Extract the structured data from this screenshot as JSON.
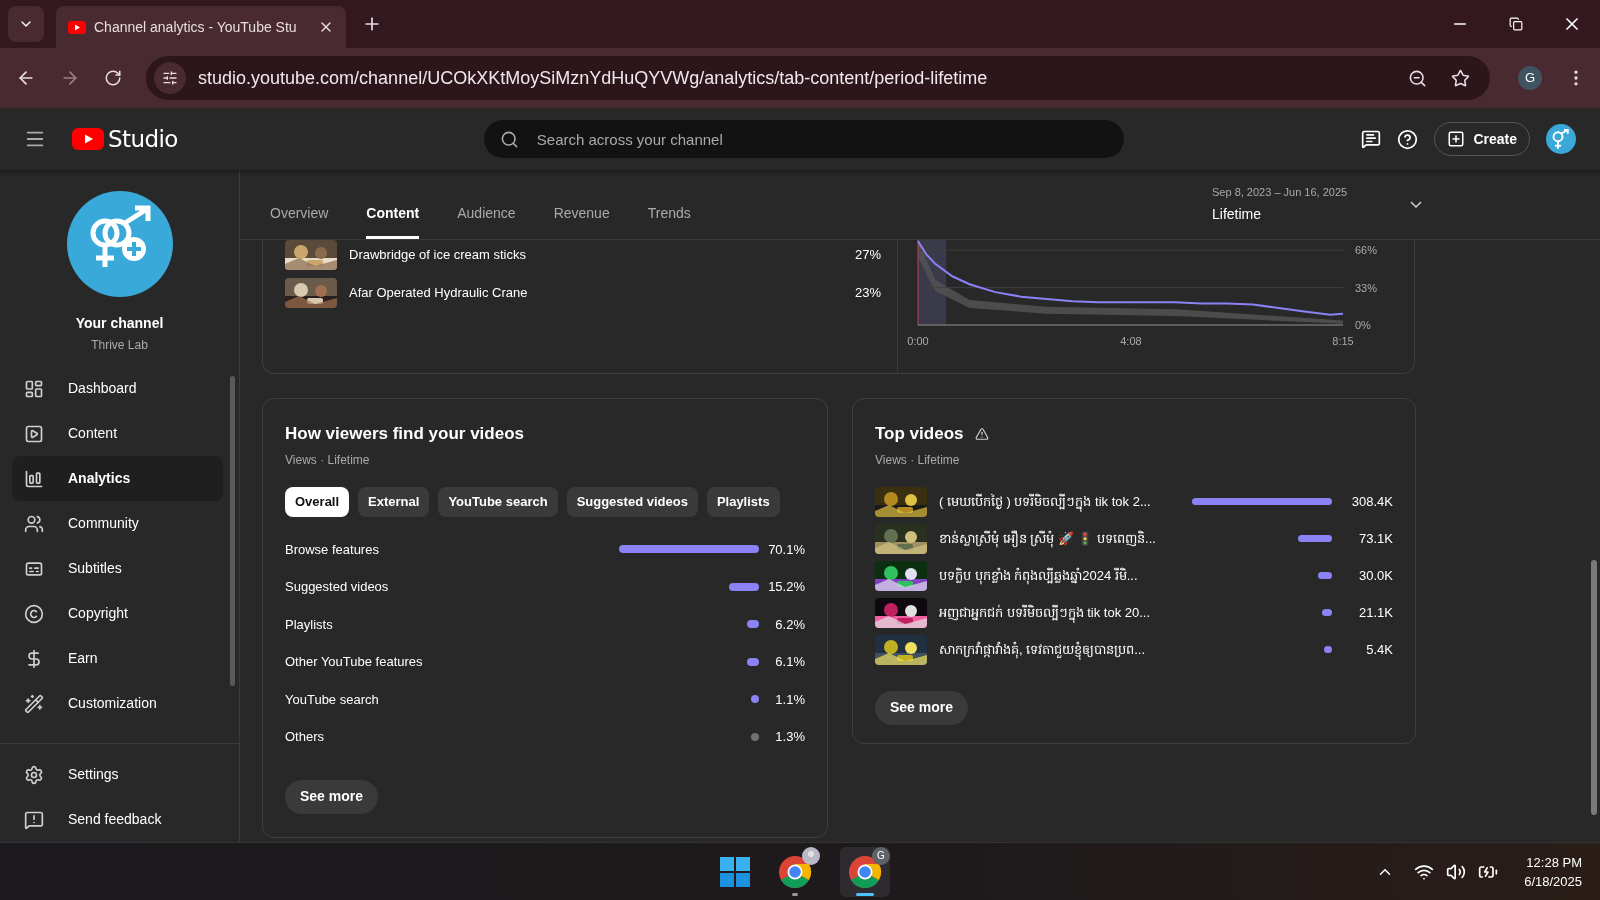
{
  "browser": {
    "tab_title": "Channel analytics - YouTube Stu",
    "url": "studio.youtube.com/channel/UCOkXKtMoySiMznYdHuQYVWg/analytics/tab-content/period-lifetime",
    "profile_initial": "G"
  },
  "header": {
    "logo_text": "Studio",
    "search_placeholder": "Search across your channel",
    "create_label": "Create"
  },
  "sidebar": {
    "channel_label": "Your channel",
    "channel_name": "Thrive Lab",
    "items": [
      {
        "label": "Dashboard",
        "selected": false
      },
      {
        "label": "Content",
        "selected": false
      },
      {
        "label": "Analytics",
        "selected": true
      },
      {
        "label": "Community",
        "selected": false
      },
      {
        "label": "Subtitles",
        "selected": false
      },
      {
        "label": "Copyright",
        "selected": false
      },
      {
        "label": "Earn",
        "selected": false
      },
      {
        "label": "Customization",
        "selected": false
      }
    ],
    "footer_items": [
      {
        "label": "Settings"
      },
      {
        "label": "Send feedback"
      }
    ]
  },
  "analytics_tabs": [
    {
      "label": "Overview",
      "selected": false
    },
    {
      "label": "Content",
      "selected": true
    },
    {
      "label": "Audience",
      "selected": false
    },
    {
      "label": "Revenue",
      "selected": false
    },
    {
      "label": "Trends",
      "selected": false
    }
  ],
  "date_range": {
    "range": "Sep 8, 2023 – Jun 16, 2025",
    "period": "Lifetime"
  },
  "retention_card": {
    "videos": [
      {
        "title": "Drawbridge of ice cream sticks",
        "share": "27%"
      },
      {
        "title": "Afar Operated Hydraulic Crane",
        "share": "23%"
      }
    ],
    "chart_data": {
      "type": "line",
      "x": [
        0,
        10,
        20,
        40,
        60,
        90,
        120,
        150,
        180,
        210,
        240,
        270,
        300,
        330,
        360,
        390,
        420,
        450,
        480,
        495
      ],
      "xlim": [
        0,
        495
      ],
      "ylim": [
        0,
        75
      ],
      "xticks": [
        {
          "value": 0,
          "label": "0:00"
        },
        {
          "value": 248,
          "label": "4:08"
        },
        {
          "value": 495,
          "label": "8:15"
        }
      ],
      "yticks": [
        {
          "value": 0,
          "label": "0%"
        },
        {
          "value": 33,
          "label": "33%"
        },
        {
          "value": 66,
          "label": "66%"
        }
      ],
      "series": [
        {
          "color": "#8b83f5",
          "values": [
            74,
            62,
            54,
            43,
            36,
            29,
            25,
            23,
            21,
            20,
            20,
            20,
            20,
            19,
            19,
            18,
            15,
            12,
            9,
            10
          ]
        }
      ]
    }
  },
  "traffic_card": {
    "title": "How viewers find your videos",
    "subtitle": "Views · Lifetime",
    "filters": [
      {
        "label": "Overall",
        "selected": true
      },
      {
        "label": "External",
        "selected": false
      },
      {
        "label": "YouTube search",
        "selected": false
      },
      {
        "label": "Suggested videos",
        "selected": false
      },
      {
        "label": "Playlists",
        "selected": false
      }
    ],
    "sources": [
      {
        "label": "Browse features",
        "value": "70.1%",
        "color": "#8b83f5"
      },
      {
        "label": "Suggested videos",
        "value": "15.2%",
        "color": "#8b83f5"
      },
      {
        "label": "Playlists",
        "value": "6.2%",
        "color": "#8b83f5"
      },
      {
        "label": "Other YouTube features",
        "value": "6.1%",
        "color": "#8b83f5"
      },
      {
        "label": "YouTube search",
        "value": "1.1%",
        "color": "#8b83f5"
      },
      {
        "label": "Others",
        "value": "1.3%",
        "color": "#717171"
      }
    ],
    "see_more": "See more"
  },
  "top_videos": {
    "title": "Top videos",
    "subtitle": "Views · Lifetime",
    "videos": [
      {
        "title": "( មេឃបើកថ្ងៃ ) បទរីមិចល្បីៗក្នុង tik tok 2...",
        "views": "308.4K"
      },
      {
        "title": "ខាន់ស្លាស្រីមុំ អឿន ស្រីមុំ 🚀 🚦 បទពេញនិ...",
        "views": "73.1K"
      },
      {
        "title": "បទក្លិប បុកខ្លាំង កំពុងល្បីឆ្លងឆ្នាំ2024 រីមិ...",
        "views": "30.0K"
      },
      {
        "title": "អញជាអ្នកជក់ បទរីមិចល្បីៗក្នុង tik tok 20...",
        "views": "21.1K"
      },
      {
        "title": "សាកក្រវាំផ្កាវាំងគុំ, ទេវតាជួយខ្ញុំឲ្យបានប្រព...",
        "views": "5.4K"
      }
    ],
    "see_more": "See more"
  },
  "taskbar": {
    "apps": [
      {
        "selected": false
      },
      {
        "selected": true,
        "badge": "G"
      }
    ],
    "time": "12:28 PM",
    "date": "6/18/2025"
  }
}
